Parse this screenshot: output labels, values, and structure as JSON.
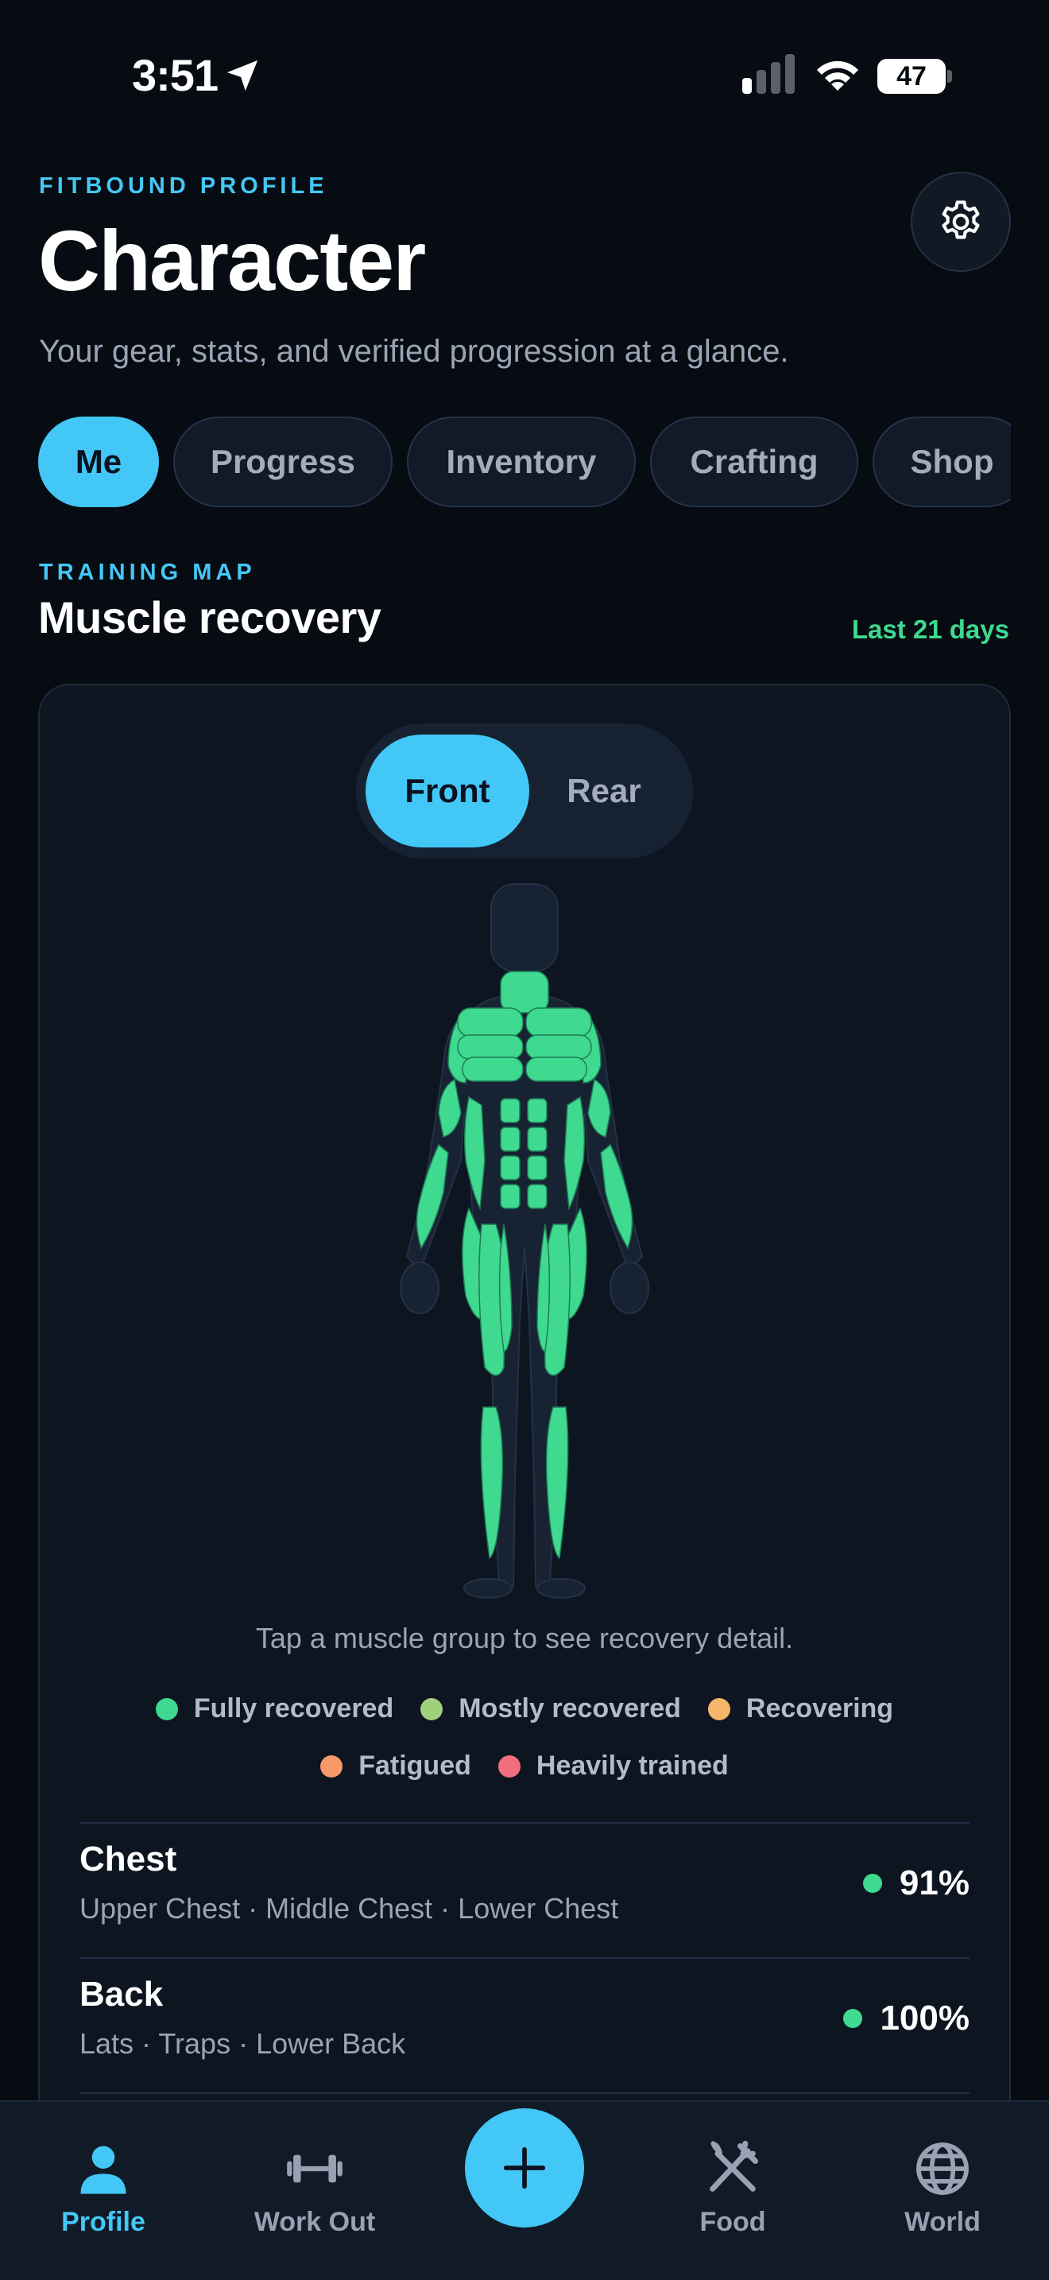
{
  "status_bar": {
    "time": "3:51",
    "battery": "47"
  },
  "header": {
    "eyebrow": "FITBOUND PROFILE",
    "title": "Character",
    "subtitle": "Your gear, stats, and verified progression at a glance."
  },
  "tabs": [
    {
      "label": "Me",
      "active": true
    },
    {
      "label": "Progress"
    },
    {
      "label": "Inventory"
    },
    {
      "label": "Crafting"
    },
    {
      "label": "Shop"
    }
  ],
  "section": {
    "eyebrow": "TRAINING MAP",
    "title": "Muscle recovery",
    "range": "Last 21 days"
  },
  "view_toggle": {
    "front": "Front",
    "rear": "Rear",
    "selected": "Front"
  },
  "hint": "Tap a muscle group to see recovery detail.",
  "legend": [
    {
      "label": "Fully recovered",
      "color": "#3fd98f"
    },
    {
      "label": "Mostly recovered",
      "color": "#9fd07a"
    },
    {
      "label": "Recovering",
      "color": "#f6b66a"
    },
    {
      "label": "Fatigued",
      "color": "#f8996a"
    },
    {
      "label": "Heavily trained",
      "color": "#f26d7d"
    }
  ],
  "muscle_groups": [
    {
      "name": "Chest",
      "parts": "Upper Chest · Middle Chest · Lower Chest",
      "recovery": "91%"
    },
    {
      "name": "Back",
      "parts": "Lats · Traps · Lower Back",
      "recovery": "100%"
    }
  ],
  "nav": [
    {
      "label": "Profile",
      "icon": "person-icon",
      "active": true
    },
    {
      "label": "Work Out",
      "icon": "dumbbell-icon"
    },
    {
      "label": "Food",
      "icon": "fork-knife-icon"
    },
    {
      "label": "World",
      "icon": "globe-icon"
    }
  ],
  "colors": {
    "accent": "#43c7f6",
    "recovered": "#3fd98f",
    "background": "#070b12"
  }
}
